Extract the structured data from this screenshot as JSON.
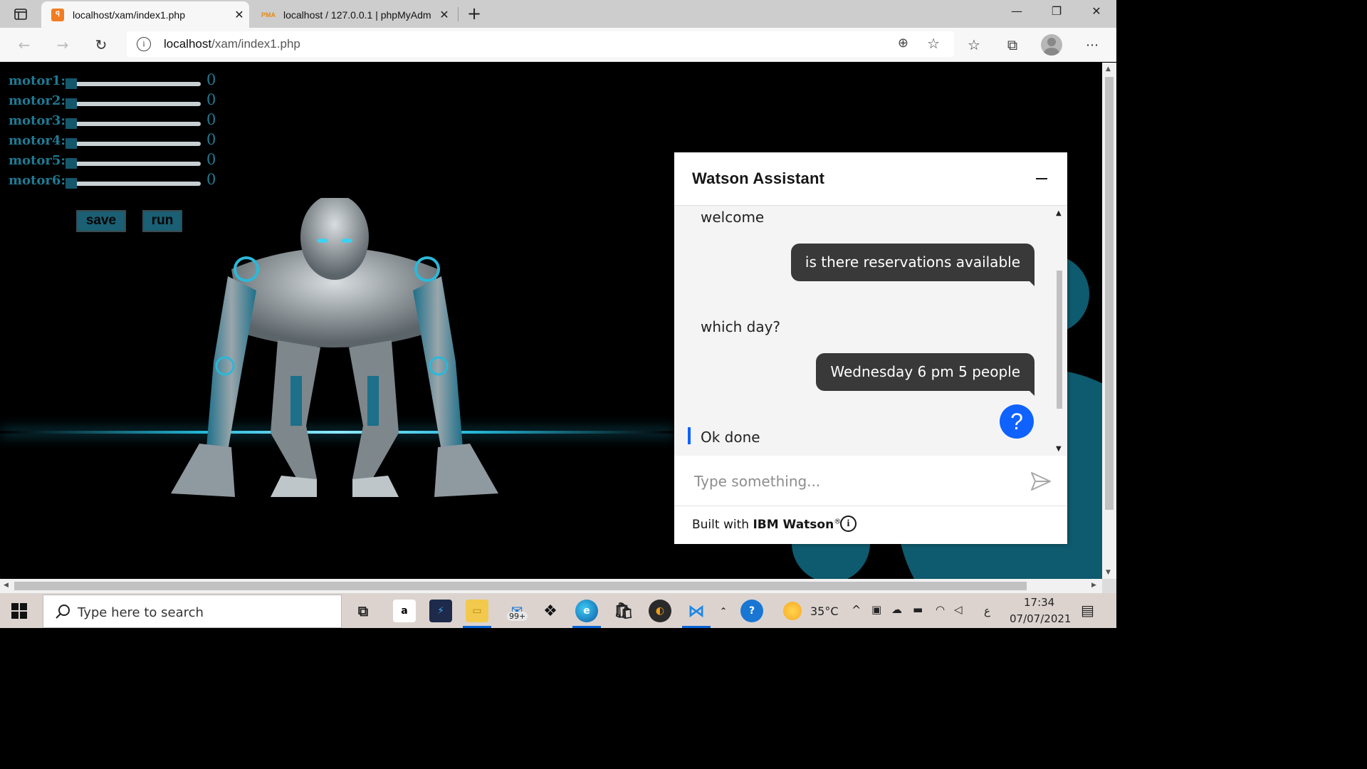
{
  "browser": {
    "tabs": [
      {
        "label": "localhost/xam/index1.php",
        "favicon": "xampp-icon",
        "active": true
      },
      {
        "label": "localhost / 127.0.0.1 | phpMyAdm",
        "favicon": "phpmyadmin-icon",
        "active": false
      }
    ],
    "new_tab_label": "+",
    "address": {
      "host": "localhost",
      "path": "/xam/index1.php"
    }
  },
  "page": {
    "motors": [
      {
        "label": "motor1:",
        "value": "0"
      },
      {
        "label": "motor2:",
        "value": "0"
      },
      {
        "label": "motor3:",
        "value": "0"
      },
      {
        "label": "motor4:",
        "value": "0"
      },
      {
        "label": "motor5:",
        "value": "0"
      },
      {
        "label": "motor6:",
        "value": "0"
      }
    ],
    "save_label": "save",
    "run_label": "run"
  },
  "watson": {
    "title": "Watson Assistant",
    "messages": [
      {
        "from": "bot",
        "text": "welcome"
      },
      {
        "from": "user",
        "text": "is there reservations available"
      },
      {
        "from": "bot",
        "text": "which day?"
      },
      {
        "from": "user",
        "text": "Wednesday 6 pm 5 people"
      },
      {
        "from": "bot",
        "text": "Ok done"
      }
    ],
    "help_label": "?",
    "input_placeholder": "Type something...",
    "footer_prefix": "Built with ",
    "footer_brand": "IBM Watson",
    "footer_reg": "®",
    "info_label": "i"
  },
  "taskbar": {
    "search_placeholder": "Type here to search",
    "mail_badge": "99+",
    "weather": "35°C",
    "lang": "ع",
    "time": "17:34",
    "date": "07/07/2021"
  },
  "colors": {
    "accent": "#0f62fe",
    "motor_text": "#1f7a93",
    "button_bg": "#1a5f73"
  }
}
